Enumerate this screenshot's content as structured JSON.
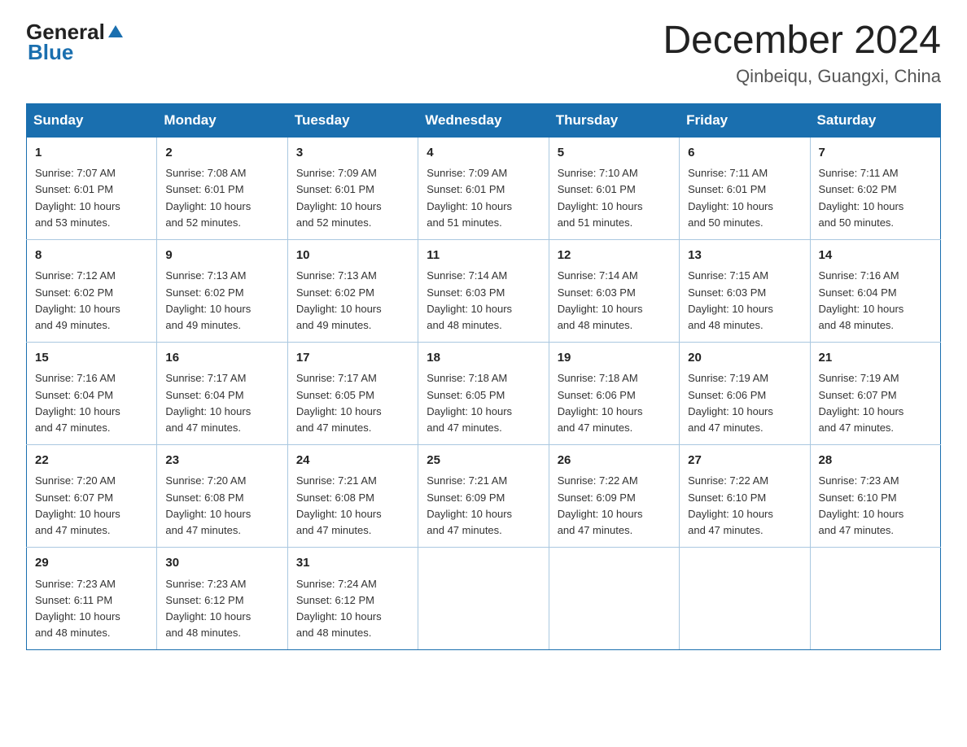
{
  "header": {
    "logo_general": "General",
    "logo_blue": "Blue",
    "month_title": "December 2024",
    "location": "Qinbeiqu, Guangxi, China"
  },
  "weekdays": [
    "Sunday",
    "Monday",
    "Tuesday",
    "Wednesday",
    "Thursday",
    "Friday",
    "Saturday"
  ],
  "weeks": [
    [
      {
        "day": "1",
        "info": "Sunrise: 7:07 AM\nSunset: 6:01 PM\nDaylight: 10 hours\nand 53 minutes."
      },
      {
        "day": "2",
        "info": "Sunrise: 7:08 AM\nSunset: 6:01 PM\nDaylight: 10 hours\nand 52 minutes."
      },
      {
        "day": "3",
        "info": "Sunrise: 7:09 AM\nSunset: 6:01 PM\nDaylight: 10 hours\nand 52 minutes."
      },
      {
        "day": "4",
        "info": "Sunrise: 7:09 AM\nSunset: 6:01 PM\nDaylight: 10 hours\nand 51 minutes."
      },
      {
        "day": "5",
        "info": "Sunrise: 7:10 AM\nSunset: 6:01 PM\nDaylight: 10 hours\nand 51 minutes."
      },
      {
        "day": "6",
        "info": "Sunrise: 7:11 AM\nSunset: 6:01 PM\nDaylight: 10 hours\nand 50 minutes."
      },
      {
        "day": "7",
        "info": "Sunrise: 7:11 AM\nSunset: 6:02 PM\nDaylight: 10 hours\nand 50 minutes."
      }
    ],
    [
      {
        "day": "8",
        "info": "Sunrise: 7:12 AM\nSunset: 6:02 PM\nDaylight: 10 hours\nand 49 minutes."
      },
      {
        "day": "9",
        "info": "Sunrise: 7:13 AM\nSunset: 6:02 PM\nDaylight: 10 hours\nand 49 minutes."
      },
      {
        "day": "10",
        "info": "Sunrise: 7:13 AM\nSunset: 6:02 PM\nDaylight: 10 hours\nand 49 minutes."
      },
      {
        "day": "11",
        "info": "Sunrise: 7:14 AM\nSunset: 6:03 PM\nDaylight: 10 hours\nand 48 minutes."
      },
      {
        "day": "12",
        "info": "Sunrise: 7:14 AM\nSunset: 6:03 PM\nDaylight: 10 hours\nand 48 minutes."
      },
      {
        "day": "13",
        "info": "Sunrise: 7:15 AM\nSunset: 6:03 PM\nDaylight: 10 hours\nand 48 minutes."
      },
      {
        "day": "14",
        "info": "Sunrise: 7:16 AM\nSunset: 6:04 PM\nDaylight: 10 hours\nand 48 minutes."
      }
    ],
    [
      {
        "day": "15",
        "info": "Sunrise: 7:16 AM\nSunset: 6:04 PM\nDaylight: 10 hours\nand 47 minutes."
      },
      {
        "day": "16",
        "info": "Sunrise: 7:17 AM\nSunset: 6:04 PM\nDaylight: 10 hours\nand 47 minutes."
      },
      {
        "day": "17",
        "info": "Sunrise: 7:17 AM\nSunset: 6:05 PM\nDaylight: 10 hours\nand 47 minutes."
      },
      {
        "day": "18",
        "info": "Sunrise: 7:18 AM\nSunset: 6:05 PM\nDaylight: 10 hours\nand 47 minutes."
      },
      {
        "day": "19",
        "info": "Sunrise: 7:18 AM\nSunset: 6:06 PM\nDaylight: 10 hours\nand 47 minutes."
      },
      {
        "day": "20",
        "info": "Sunrise: 7:19 AM\nSunset: 6:06 PM\nDaylight: 10 hours\nand 47 minutes."
      },
      {
        "day": "21",
        "info": "Sunrise: 7:19 AM\nSunset: 6:07 PM\nDaylight: 10 hours\nand 47 minutes."
      }
    ],
    [
      {
        "day": "22",
        "info": "Sunrise: 7:20 AM\nSunset: 6:07 PM\nDaylight: 10 hours\nand 47 minutes."
      },
      {
        "day": "23",
        "info": "Sunrise: 7:20 AM\nSunset: 6:08 PM\nDaylight: 10 hours\nand 47 minutes."
      },
      {
        "day": "24",
        "info": "Sunrise: 7:21 AM\nSunset: 6:08 PM\nDaylight: 10 hours\nand 47 minutes."
      },
      {
        "day": "25",
        "info": "Sunrise: 7:21 AM\nSunset: 6:09 PM\nDaylight: 10 hours\nand 47 minutes."
      },
      {
        "day": "26",
        "info": "Sunrise: 7:22 AM\nSunset: 6:09 PM\nDaylight: 10 hours\nand 47 minutes."
      },
      {
        "day": "27",
        "info": "Sunrise: 7:22 AM\nSunset: 6:10 PM\nDaylight: 10 hours\nand 47 minutes."
      },
      {
        "day": "28",
        "info": "Sunrise: 7:23 AM\nSunset: 6:10 PM\nDaylight: 10 hours\nand 47 minutes."
      }
    ],
    [
      {
        "day": "29",
        "info": "Sunrise: 7:23 AM\nSunset: 6:11 PM\nDaylight: 10 hours\nand 48 minutes."
      },
      {
        "day": "30",
        "info": "Sunrise: 7:23 AM\nSunset: 6:12 PM\nDaylight: 10 hours\nand 48 minutes."
      },
      {
        "day": "31",
        "info": "Sunrise: 7:24 AM\nSunset: 6:12 PM\nDaylight: 10 hours\nand 48 minutes."
      },
      {
        "day": "",
        "info": ""
      },
      {
        "day": "",
        "info": ""
      },
      {
        "day": "",
        "info": ""
      },
      {
        "day": "",
        "info": ""
      }
    ]
  ]
}
